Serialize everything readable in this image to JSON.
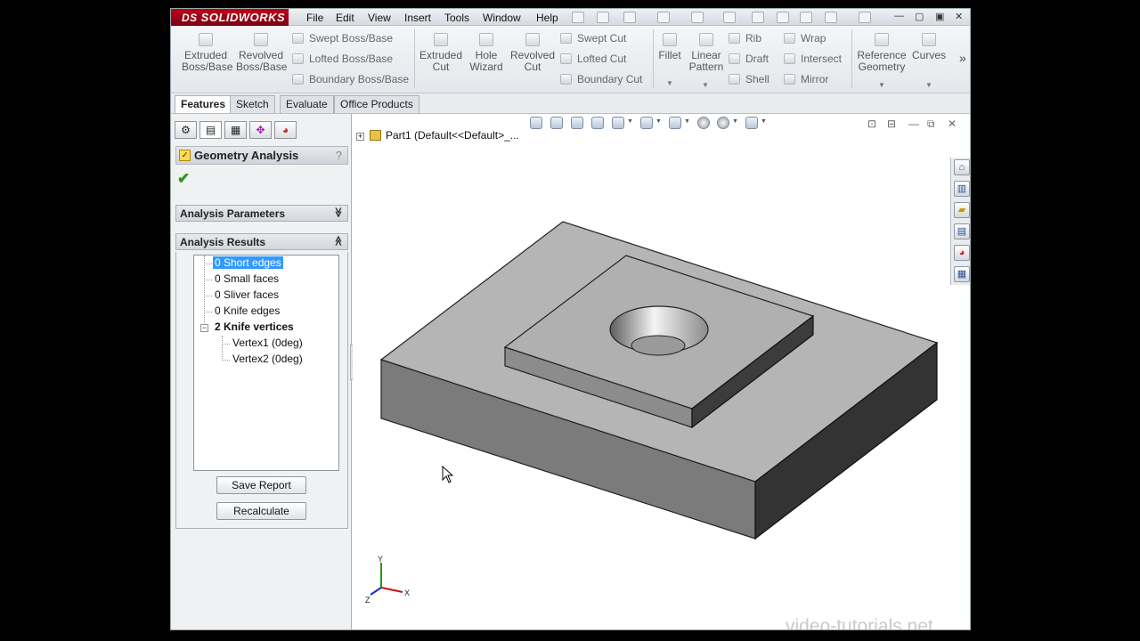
{
  "app": {
    "logo_brand": "SOLIDWORKS",
    "logo_prefix": "DS"
  },
  "menu": [
    "File",
    "Edit",
    "View",
    "Insert",
    "Tools",
    "Window",
    "Help"
  ],
  "toolbar": {
    "extruded_boss": [
      "Extruded",
      "Boss/Base"
    ],
    "revolved_boss": [
      "Revolved",
      "Boss/Base"
    ],
    "swept_boss": "Swept Boss/Base",
    "lofted_boss": "Lofted Boss/Base",
    "boundary_boss": "Boundary Boss/Base",
    "extruded_cut": [
      "Extruded",
      "Cut"
    ],
    "hole_wizard": [
      "Hole",
      "Wizard"
    ],
    "revolved_cut": [
      "Revolved",
      "Cut"
    ],
    "swept_cut": "Swept Cut",
    "lofted_cut": "Lofted Cut",
    "boundary_cut": "Boundary Cut",
    "fillet": "Fillet",
    "linear_pattern": [
      "Linear",
      "Pattern"
    ],
    "rib": "Rib",
    "draft": "Draft",
    "shell": "Shell",
    "wrap": "Wrap",
    "intersect": "Intersect",
    "mirror": "Mirror",
    "reference_geometry": [
      "Reference",
      "Geometry"
    ],
    "curves": "Curves",
    "more": "»"
  },
  "tabs": [
    "Features",
    "Sketch",
    "Evaluate",
    "Office Products"
  ],
  "property_manager": {
    "title": "Geometry Analysis",
    "help": "?",
    "ok": "✔",
    "analysis_parameters": "Analysis Parameters",
    "analysis_results": "Analysis Results",
    "collapse_chevron": "≪",
    "expand_chevron": "≫",
    "results": [
      {
        "label": "0 Short edges",
        "selected": true
      },
      {
        "label": "0 Small faces"
      },
      {
        "label": "0 Sliver faces"
      },
      {
        "label": "0 Knife edges"
      },
      {
        "label": "2 Knife vertices",
        "bold": true
      }
    ],
    "vertices": [
      "Vertex1 (0deg)",
      "Vertex2 (0deg)"
    ],
    "save_report": "Save Report",
    "recalculate": "Recalculate"
  },
  "graphics": {
    "part_label": "Part1  (Default<<Default>_...",
    "triad": {
      "x": "X",
      "y": "Y",
      "z": "Z"
    }
  },
  "watermark": "video-tutorials.net",
  "colors": {
    "selection": "#3399ff",
    "brand": "#b0001a",
    "model_top": "#b4b4b4"
  }
}
